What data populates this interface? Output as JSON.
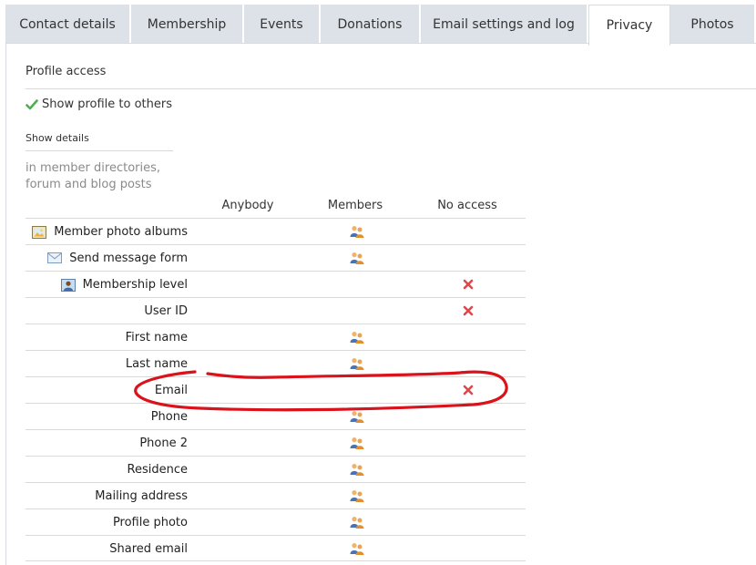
{
  "tabs": [
    {
      "label": "Contact details",
      "active": false
    },
    {
      "label": "Membership",
      "active": false
    },
    {
      "label": "Events",
      "active": false
    },
    {
      "label": "Donations",
      "active": false
    },
    {
      "label": "Email settings and log",
      "active": false
    },
    {
      "label": "Privacy",
      "active": true
    },
    {
      "label": "Photos",
      "active": false
    }
  ],
  "section": {
    "title": "Profile access",
    "show_profile": "Show profile to others",
    "show_details": "Show details",
    "description": "in member directories, forum and blog posts"
  },
  "columns": {
    "anybody": "Anybody",
    "members": "Members",
    "no_access": "No access"
  },
  "rows": [
    {
      "label": "Member photo albums",
      "icon": "photo-album-icon",
      "access": "members"
    },
    {
      "label": "Send message form",
      "icon": "envelope-icon",
      "access": "members"
    },
    {
      "label": "Membership level",
      "icon": "member-card-icon",
      "access": "no_access"
    },
    {
      "label": "User ID",
      "icon": "",
      "access": "no_access"
    },
    {
      "label": "First name",
      "icon": "",
      "access": "members"
    },
    {
      "label": "Last name",
      "icon": "",
      "access": "members"
    },
    {
      "label": "Email",
      "icon": "",
      "access": "no_access"
    },
    {
      "label": "Phone",
      "icon": "",
      "access": "members"
    },
    {
      "label": "Phone 2",
      "icon": "",
      "access": "members"
    },
    {
      "label": "Residence",
      "icon": "",
      "access": "members"
    },
    {
      "label": "Mailing address",
      "icon": "",
      "access": "members"
    },
    {
      "label": "Profile photo",
      "icon": "",
      "access": "members"
    },
    {
      "label": "Shared email",
      "icon": "",
      "access": "members"
    }
  ],
  "colors": {
    "check": "#4caf50",
    "no_access": "#e0474c",
    "annotation": "#d9121b"
  }
}
